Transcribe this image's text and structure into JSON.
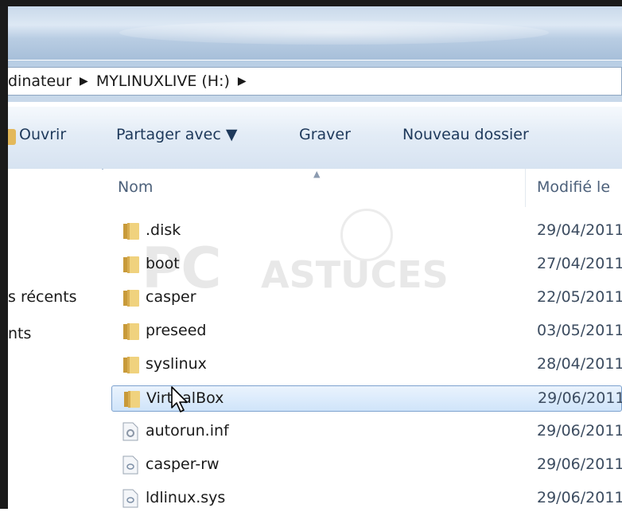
{
  "address": {
    "crumbs": [
      "dinateur",
      "MYLINUXLIVE (H:)"
    ],
    "separator": "▶"
  },
  "toolbar": {
    "open_label": "Ouvrir",
    "share_label": "Partager avec ▼",
    "burn_label": "Graver",
    "new_folder_label": "Nouveau dossier"
  },
  "nav": {
    "items": [
      "s récents",
      "nts"
    ]
  },
  "columns": {
    "name": "Nom",
    "modified": "Modifié le"
  },
  "files": [
    {
      "name": ".disk",
      "date": "29/04/2011",
      "type": "folder"
    },
    {
      "name": "boot",
      "date": "27/04/2011",
      "type": "folder"
    },
    {
      "name": "casper",
      "date": "22/05/2011",
      "type": "folder"
    },
    {
      "name": "preseed",
      "date": "03/05/2011",
      "type": "folder"
    },
    {
      "name": "syslinux",
      "date": "28/04/2011",
      "type": "folder"
    },
    {
      "name": "VirtualBox",
      "date": "29/06/2011",
      "type": "folder",
      "selected": true
    },
    {
      "name": "autorun.inf",
      "date": "29/06/2011",
      "type": "inf"
    },
    {
      "name": "casper-rw",
      "date": "29/06/2011",
      "type": "file"
    },
    {
      "name": "ldlinux.sys",
      "date": "29/06/2011",
      "type": "file"
    }
  ],
  "watermark": {
    "pc": "PC",
    "astuces": "ASTUCES"
  },
  "colors": {
    "selection": "#cfe4fa",
    "folder": "#e8c46a",
    "toolbar_text": "#1e395b"
  }
}
